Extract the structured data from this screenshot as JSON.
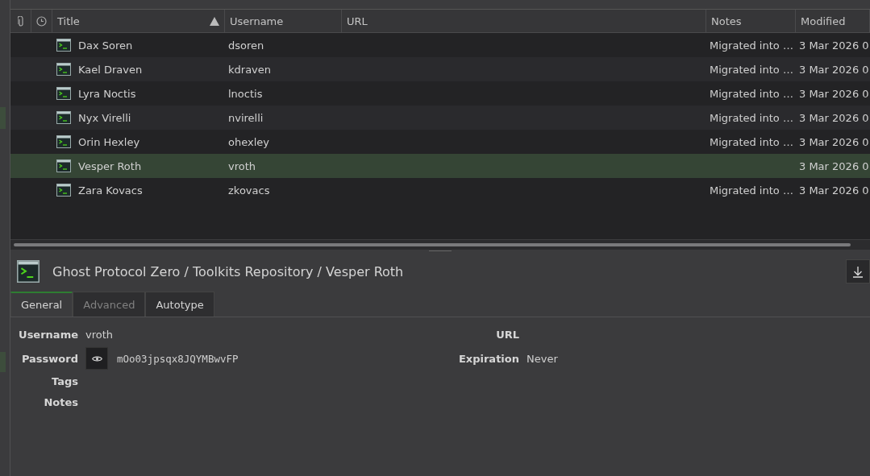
{
  "table": {
    "columns": [
      {
        "kind": "attachment"
      },
      {
        "kind": "clock"
      },
      {
        "kind": "text",
        "label": "Title",
        "sorted_ascending": true
      },
      {
        "kind": "text",
        "label": "Username"
      },
      {
        "kind": "text",
        "label": "URL"
      },
      {
        "kind": "text",
        "label": "Notes"
      },
      {
        "kind": "text",
        "label": "Modified"
      }
    ],
    "rows": [
      {
        "title": "Dax Soren",
        "username": "dsoren",
        "notes": "Migrated into …",
        "modified": "3 Mar 2026 0",
        "selected": false
      },
      {
        "title": "Kael Draven",
        "username": "kdraven",
        "notes": "Migrated into …",
        "modified": "3 Mar 2026 0",
        "selected": false
      },
      {
        "title": "Lyra Noctis",
        "username": "lnoctis",
        "notes": "Migrated into …",
        "modified": "3 Mar 2026 0",
        "selected": false
      },
      {
        "title": "Nyx Virelli",
        "username": "nvirelli",
        "notes": "Migrated into …",
        "modified": "3 Mar 2026 0",
        "selected": false
      },
      {
        "title": "Orin Hexley",
        "username": "ohexley",
        "notes": "Migrated into …",
        "modified": "3 Mar 2026 0",
        "selected": false
      },
      {
        "title": "Vesper Roth",
        "username": "vroth",
        "modified": "3 Mar 2026 0",
        "selected": true
      },
      {
        "title": "Zara Kovacs",
        "username": "zkovacs",
        "notes": "Migrated into …",
        "modified": "3 Mar 2026 0",
        "selected": false
      }
    ]
  },
  "details": {
    "breadcrumb": "Ghost Protocol Zero / Toolkits Repository / Vesper Roth",
    "tabs": [
      {
        "label": "General",
        "selected": true,
        "disabled": false
      },
      {
        "label": "Advanced",
        "selected": false,
        "disabled": true
      },
      {
        "label": "Autotype",
        "selected": false,
        "disabled": false
      }
    ],
    "left_fields": [
      {
        "label": "Username",
        "value": "vroth",
        "kind": "text"
      },
      {
        "label": "Password",
        "value": "mOo03jpsqx8JQYMBwvFP",
        "kind": "password"
      },
      {
        "label": "Tags",
        "kind": "text"
      },
      {
        "label": "Notes",
        "kind": "text"
      }
    ],
    "right_fields": [
      {
        "label": "URL"
      },
      {
        "label": "Expiration",
        "value": "Never"
      }
    ]
  }
}
